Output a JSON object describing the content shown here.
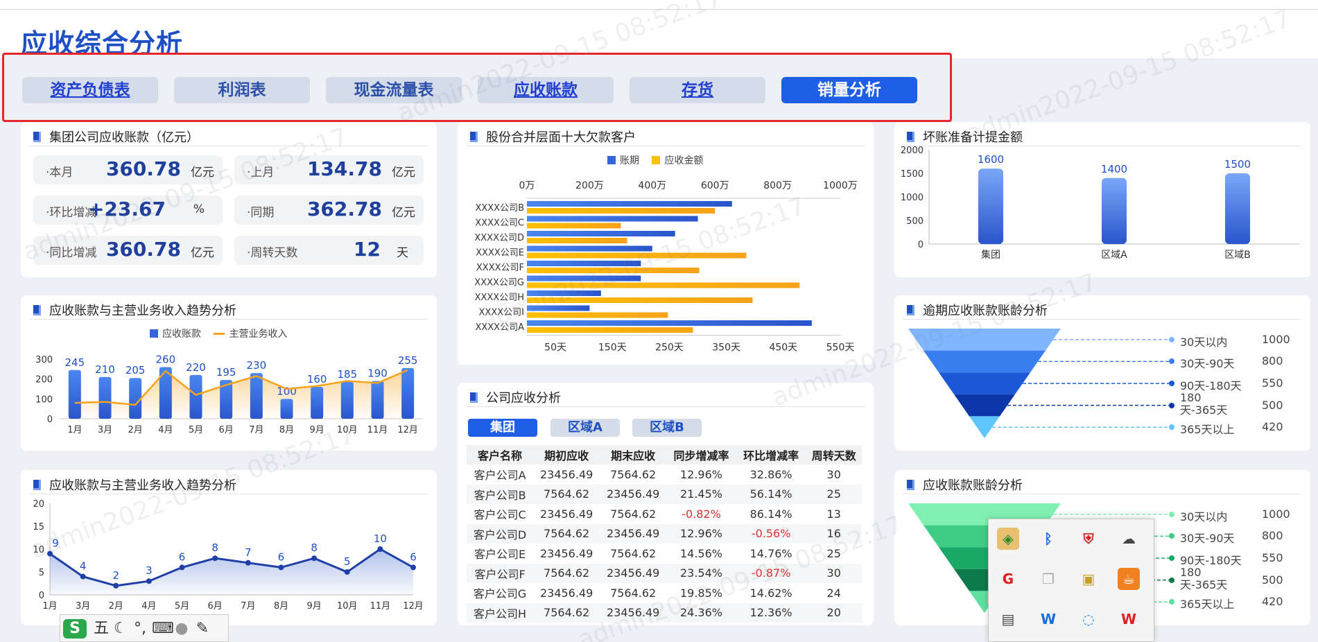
{
  "page": {
    "title": "应收综合分析"
  },
  "tabs": [
    {
      "label": "资产负债表",
      "style": "link"
    },
    {
      "label": "利润表",
      "style": "plain"
    },
    {
      "label": "现金流量表",
      "style": "plain"
    },
    {
      "label": "应收账款",
      "style": "link"
    },
    {
      "label": "存货",
      "style": "link"
    },
    {
      "label": "销量分析",
      "style": "active"
    }
  ],
  "kpi_card": {
    "title": "集团公司应收账款（亿元）",
    "items": [
      {
        "label": "·本月",
        "value": "360.78",
        "unit": "亿元"
      },
      {
        "label": "·上月",
        "value": "134.78",
        "unit": "亿元"
      },
      {
        "label": "·环比增减",
        "value": "+23.67",
        "unit": "%"
      },
      {
        "label": "·同期",
        "value": "362.78",
        "unit": "亿元"
      },
      {
        "label": "·同比增减",
        "value": "360.78",
        "unit": "亿元"
      },
      {
        "label": "·周转天数",
        "value": "12",
        "unit": "天"
      }
    ]
  },
  "trend_card": {
    "title": "应收账款与主营业务收入趋势分析"
  },
  "trend_line_card": {
    "title": "应收账款与主营业务收入趋势分析"
  },
  "top10_card": {
    "title": "股份合并层面十大欠款客户"
  },
  "baddebt_card": {
    "title": "坏账准备计提金额"
  },
  "company_card": {
    "title": "公司应收分析",
    "subtabs": [
      "集团",
      "区域A",
      "区域B"
    ],
    "table": {
      "headers": [
        "客户名称",
        "期初应收",
        "期末应收",
        "同步增减率",
        "环比增减率",
        "周转天数"
      ],
      "rows": [
        [
          "客户公司A",
          "23456.49",
          "7564.62",
          "12.96%",
          "32.86%",
          "30"
        ],
        [
          "客户公司B",
          "7564.62",
          "23456.49",
          "21.45%",
          "56.14%",
          "25"
        ],
        [
          "客户公司C",
          "23456.49",
          "7564.62",
          "-0.82%",
          "86.14%",
          "13"
        ],
        [
          "客户公司D",
          "7564.62",
          "23456.49",
          "12.96%",
          "-0.56%",
          "16"
        ],
        [
          "客户公司E",
          "23456.49",
          "7564.62",
          "14.56%",
          "14.76%",
          "25"
        ],
        [
          "客户公司F",
          "7564.62",
          "23456.49",
          "23.54%",
          "-0.87%",
          "30"
        ],
        [
          "客户公司G",
          "23456.49",
          "7564.62",
          "19.85%",
          "14.62%",
          "24"
        ],
        [
          "客户公司H",
          "7564.62",
          "23456.49",
          "24.36%",
          "12.36%",
          "20"
        ]
      ]
    }
  },
  "overdue_card": {
    "title": "逾期应收账款账龄分析"
  },
  "aging_card": {
    "title": "应收账款账龄分析"
  },
  "watermark": "admin2022-09-15 08:52:17",
  "ime": {
    "label": "五"
  },
  "colors": {
    "primary": "#1f5ee6",
    "orange": "#f7a21b",
    "yellow": "#ffc000",
    "bar_blue": "#3366dd",
    "navy": "#1f3f9c"
  },
  "chart_data": [
    {
      "id": "trend",
      "type": "bar",
      "categories": [
        "1月",
        "3月",
        "2月",
        "4月",
        "5月",
        "6月",
        "7月",
        "8月",
        "9月",
        "10月",
        "11月",
        "12月"
      ],
      "series": [
        {
          "name": "应收账款",
          "type": "bar",
          "values": [
            245,
            210,
            205,
            260,
            220,
            195,
            230,
            100,
            160,
            185,
            190,
            255
          ]
        },
        {
          "name": "主营业务收入",
          "type": "line",
          "values": [
            80,
            85,
            70,
            240,
            120,
            170,
            215,
            150,
            165,
            190,
            180,
            245
          ]
        }
      ],
      "ylim": [
        0,
        300
      ],
      "yticks": [
        "0",
        "100",
        "200",
        "300"
      ]
    },
    {
      "id": "trend_line",
      "type": "area",
      "categories": [
        "1月",
        "3月",
        "2月",
        "4月",
        "5月",
        "6月",
        "7月",
        "8月",
        "9月",
        "10月",
        "11月",
        "12月"
      ],
      "series": [
        {
          "values": [
            9,
            4,
            2,
            3,
            6,
            8,
            7,
            6,
            8,
            5,
            10,
            6
          ]
        }
      ],
      "ylim": [
        0,
        20
      ],
      "yticks": [
        "0",
        "5",
        "10",
        "15",
        "20"
      ]
    },
    {
      "id": "top10",
      "type": "bar",
      "orientation": "horizontal",
      "categories": [
        "XXXX公司B",
        "XXXX公司C",
        "XXXX公司D",
        "XXXX公司E",
        "XXXX公司F",
        "XXXX公司G",
        "XXXX公司H",
        "XXXX公司I",
        "XXXX公司A"
      ],
      "series": [
        {
          "name": "账期",
          "axis": "bottom",
          "values": [
            360,
            300,
            260,
            220,
            200,
            200,
            130,
            110,
            500
          ]
        },
        {
          "name": "应收金额",
          "axis": "top",
          "values": [
            600,
            300,
            320,
            700,
            550,
            870,
            720,
            450,
            530
          ]
        }
      ],
      "top_axis_ticks": [
        "0万",
        "200万",
        "400万",
        "600万",
        "800万",
        "1000万"
      ],
      "top_axis_range": [
        0,
        1000
      ],
      "bottom_axis_ticks": [
        "50天",
        "150天",
        "250天",
        "350天",
        "450天",
        "550天"
      ],
      "bottom_axis_range": [
        0,
        550
      ]
    },
    {
      "id": "baddebt",
      "type": "bar",
      "categories": [
        "集团",
        "区域A",
        "区域B"
      ],
      "values": [
        1600,
        1400,
        1500
      ],
      "value_labels": [
        "1600",
        "1400",
        "1500"
      ],
      "ylim": [
        0,
        2000
      ],
      "yticks": [
        "0",
        "500",
        "1000",
        "1500",
        "2000"
      ]
    },
    {
      "id": "overdue",
      "type": "funnel",
      "labels": [
        "30天以内",
        "30天-90天",
        "90天-180天",
        "180天-365天",
        "365天以上"
      ],
      "values": [
        "1000",
        "800",
        "550",
        "500",
        "420"
      ],
      "colors": [
        "#7fb6ff",
        "#3b7ef0",
        "#1a58d8",
        "#0d36a8",
        "#5ec5ff"
      ]
    },
    {
      "id": "aging",
      "type": "funnel",
      "labels": [
        "30天以内",
        "30天-90天",
        "90天-180天",
        "180天-365天",
        "365天以上"
      ],
      "values": [
        "1000",
        "800",
        "550",
        "500",
        "420"
      ],
      "colors": [
        "#7ff0b0",
        "#3fcc85",
        "#1aa868",
        "#0d7a4a",
        "#5ee0a0"
      ]
    }
  ]
}
